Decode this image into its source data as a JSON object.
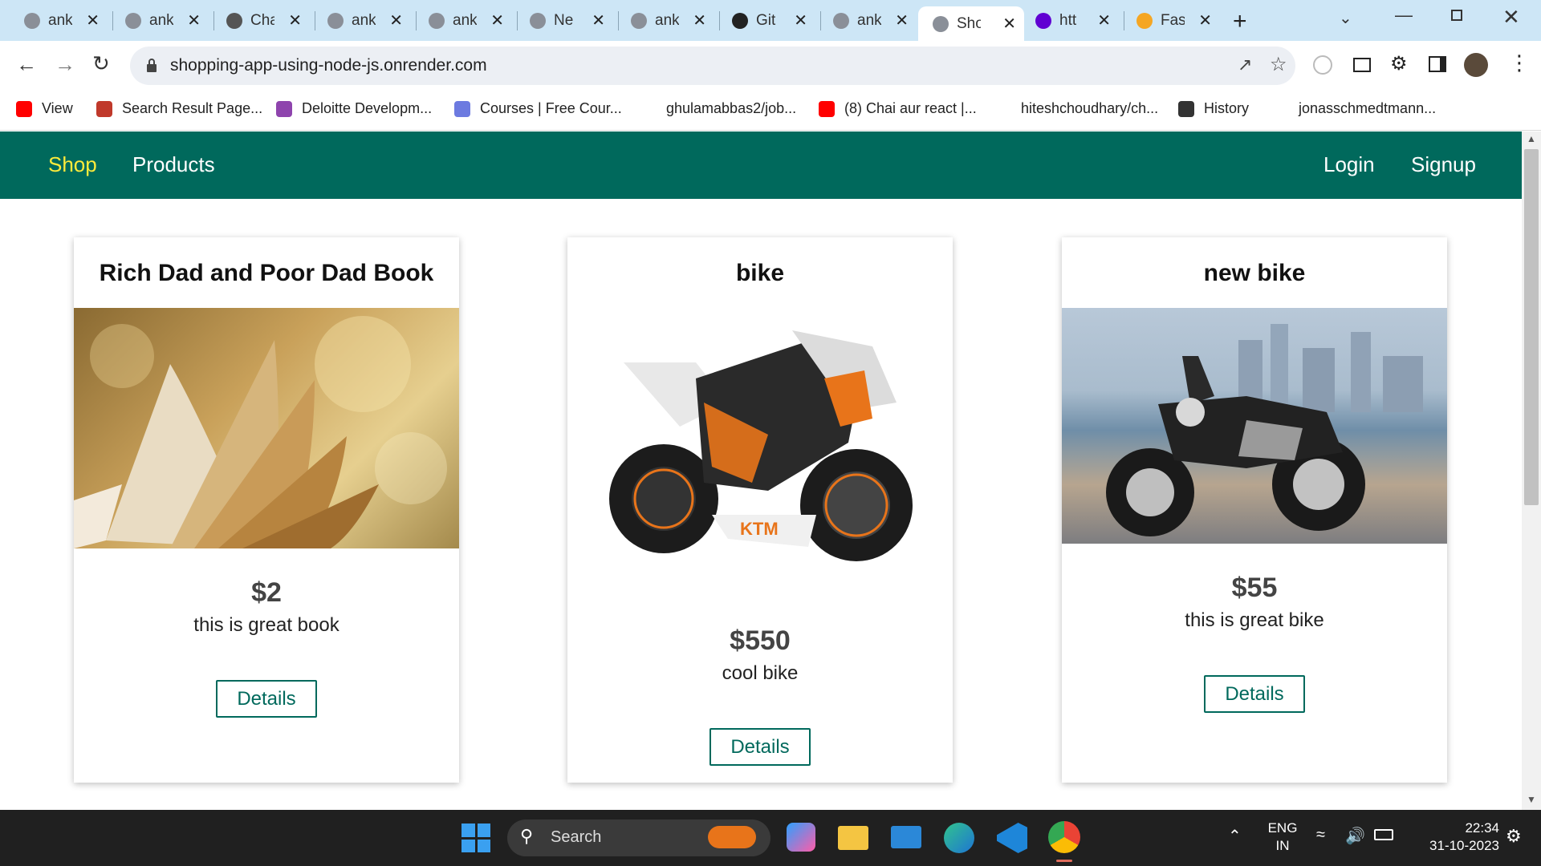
{
  "browser": {
    "tabs": [
      {
        "title": "ank",
        "icon": "globe-icon",
        "color": "#8a8f98"
      },
      {
        "title": "ank",
        "icon": "globe-icon",
        "color": "#8a8f98"
      },
      {
        "title": "Cha",
        "icon": "chatgpt-icon",
        "color": "#555"
      },
      {
        "title": "ank",
        "icon": "globe-icon",
        "color": "#8a8f98"
      },
      {
        "title": "ank",
        "icon": "globe-icon",
        "color": "#8a8f98"
      },
      {
        "title": "Ne",
        "icon": "globe-icon",
        "color": "#8a8f98"
      },
      {
        "title": "ank",
        "icon": "globe-icon",
        "color": "#8a8f98"
      },
      {
        "title": "Git",
        "icon": "github-icon",
        "color": "#222"
      },
      {
        "title": "ank",
        "icon": "globe-icon",
        "color": "#8a8f98"
      },
      {
        "title": "Sho",
        "icon": "globe-icon",
        "color": "#8a8f98",
        "active": true
      },
      {
        "title": "htt",
        "icon": "yahoo-icon",
        "color": "#6001d2"
      },
      {
        "title": "Fas",
        "icon": "pizza-icon",
        "color": "#f5a623"
      }
    ],
    "url": "shopping-app-using-node-js.onrender.com",
    "bookmarks": [
      {
        "label": "View",
        "icon": "youtube-icon",
        "color": "#ff0000"
      },
      {
        "label": "Search Result Page...",
        "icon": "dw-icon",
        "color": "#c0392b"
      },
      {
        "label": "Deloitte Developm...",
        "icon": "udemy-icon",
        "color": "#8e44ad"
      },
      {
        "label": "Courses | Free Cour...",
        "icon": "courses-icon",
        "color": "#6c7ae0"
      },
      {
        "label": "ghulamabbas2/job...",
        "icon": "",
        "color": ""
      },
      {
        "label": "(8) Chai aur react |...",
        "icon": "youtube-icon",
        "color": "#ff0000"
      },
      {
        "label": "hiteshchoudhary/ch...",
        "icon": "",
        "color": ""
      },
      {
        "label": "History",
        "icon": "history-icon",
        "color": "#333"
      },
      {
        "label": "jonasschmedtmann...",
        "icon": "",
        "color": ""
      }
    ]
  },
  "nav": {
    "brand": "Shop",
    "products": "Products",
    "login": "Login",
    "signup": "Signup",
    "color": "#00695c",
    "active_color": "#ffeb3b"
  },
  "products": [
    {
      "title": "Rich Dad and Poor Dad Book",
      "price": "$2",
      "description": "this is great book",
      "button": "Details"
    },
    {
      "title": "bike",
      "price": "$550",
      "description": "cool bike",
      "button": "Details"
    },
    {
      "title": "new bike",
      "price": "$55",
      "description": "this is great bike",
      "button": "Details"
    }
  ],
  "taskbar": {
    "search": "Search",
    "lang": "ENG",
    "region": "IN",
    "time": "22:34",
    "date": "31-10-2023"
  }
}
